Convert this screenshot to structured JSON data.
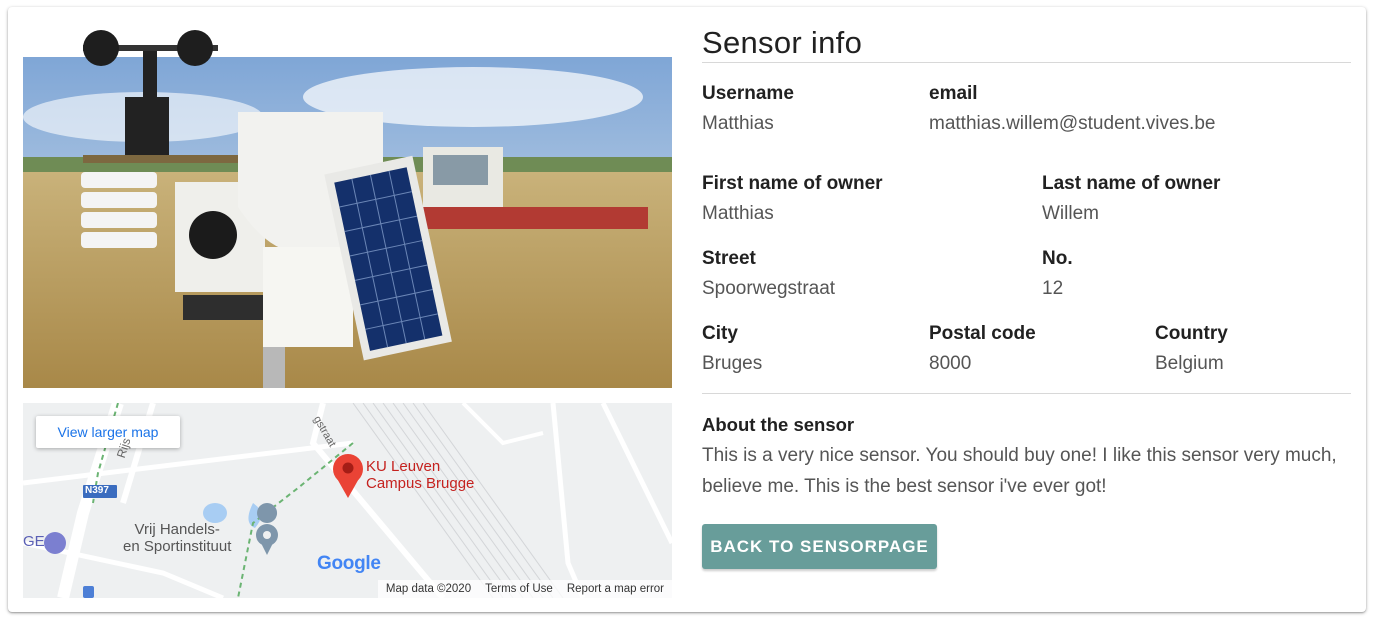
{
  "sensor_info": {
    "title": "Sensor info",
    "username_label": "Username",
    "username_value": "Matthias",
    "email_label": "email",
    "email_value": "matthias.willem@student.vives.be",
    "first_name_label": "First name of owner",
    "first_name_value": "Matthias",
    "last_name_label": "Last name of owner",
    "last_name_value": "Willem",
    "street_label": "Street",
    "street_value": "Spoorwegstraat",
    "number_label": "No.",
    "number_value": "12",
    "city_label": "City",
    "city_value": "Bruges",
    "postal_label": "Postal code",
    "postal_value": "8000",
    "country_label": "Country",
    "country_value": "Belgium",
    "about_label": "About the sensor",
    "about_text": "This is a very nice sensor. You should buy one! I like this sensor very much, believe me. This is the best sensor i've ever got!",
    "back_button": "Back to sensorpage"
  },
  "map": {
    "view_larger": "View larger map",
    "place_name_line1": "KU Leuven",
    "place_name_line2": "Campus Brugge",
    "poi_line1": "Vrij Handels-",
    "poi_line2": "en Sportinstituut",
    "road_label": "N397",
    "street_fragment1": "Rijs",
    "street_fragment2": "gstraat",
    "edge_fragment": "GE",
    "google_logo": "Google",
    "map_data": "Map data ©2020",
    "terms": "Terms of Use",
    "report": "Report a map error"
  },
  "colors": {
    "accent_button": "#689d9a",
    "map_link": "#1a73e8",
    "pin": "#ea4335"
  }
}
